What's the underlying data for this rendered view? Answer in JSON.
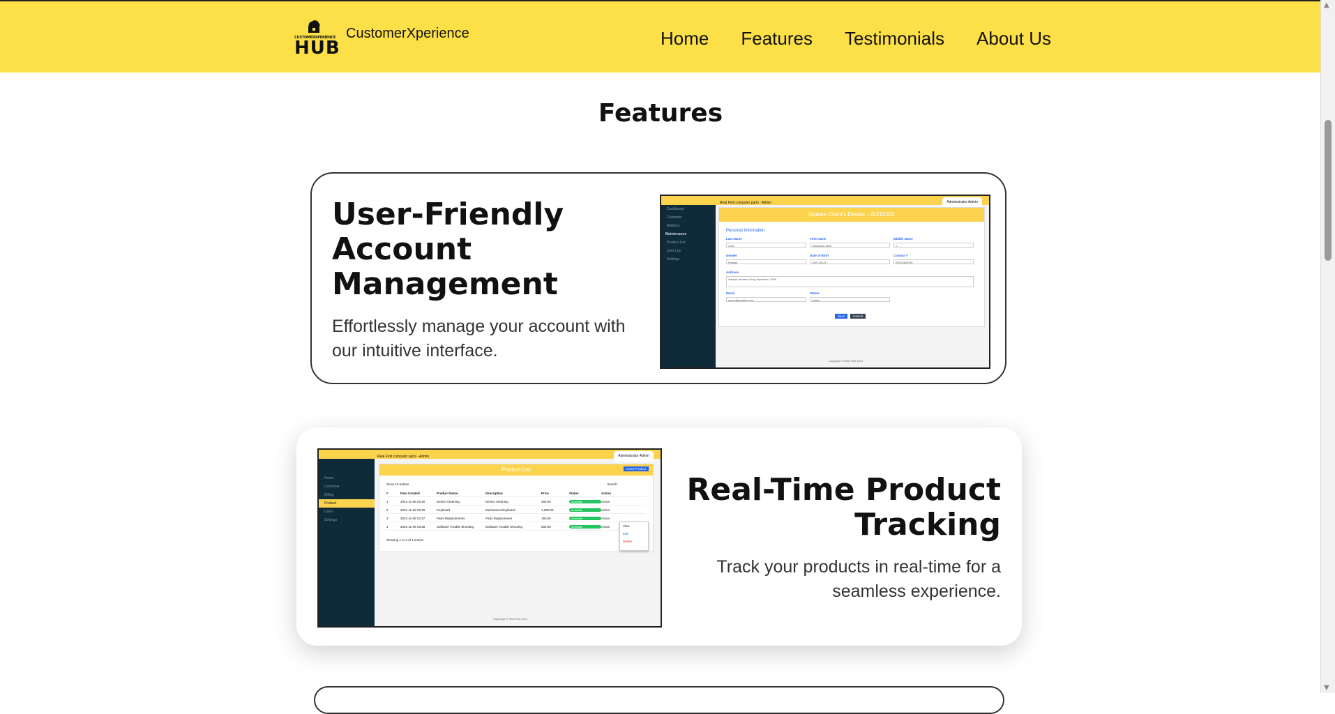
{
  "nav": {
    "logo_tagline": "CUSTOMERXPERIENCE",
    "logo_text": "HUB",
    "brand_name": "CustomerXperience",
    "links": [
      "Home",
      "Features",
      "Testimonials",
      "About Us"
    ]
  },
  "section": {
    "title": "Features"
  },
  "features": [
    {
      "title": "User-Friendly Account Management",
      "description": "Effortlessly manage your account with our intuitive interface.",
      "preview": {
        "app_title": "Real Finit computer parts - Admin",
        "admin_label": "Administrator Admin",
        "sidebar": [
          "Dashboard",
          "Customer",
          "Address",
          "Maintenance",
          "Product List",
          "User List",
          "Settings"
        ],
        "form_title": "Update Client's Details - 20210002",
        "section": "Personal Information",
        "labels": [
          "Last Name",
          "First Name",
          "Middle Name",
          "Gender",
          "Date of Birth",
          "Contact #",
          "Address",
          "Email",
          "Status"
        ],
        "values": [
          "Cruz",
          "Samantha Jane",
          "C",
          "Female",
          "1997-06-23",
          "09123456789",
          "Sample Address Only, Anywhere, 2306",
          "sjcruz@sample.com",
          "Active"
        ],
        "buttons": [
          "Save",
          "Cancel"
        ],
        "footer": "Copyright © Real Finit 2021"
      }
    },
    {
      "title": "Real-Time Product Tracking",
      "description": "Track your products in real-time for a seamless experience.",
      "preview": {
        "app_title": "Real Finit computer parts - Admin",
        "admin_label": "Administrator Admin",
        "sidebar": [
          "Home",
          "Customer",
          "Billing",
          "Product",
          "Users",
          "Settings"
        ],
        "active_item": "Product",
        "list_title": "Product List",
        "add_button": "Insert Product",
        "show_label": "Show 10 entries",
        "search_label": "Search:",
        "columns": [
          "#",
          "Date Created",
          "Product Name",
          "Description",
          "Price",
          "Status",
          "Action"
        ],
        "rows": [
          [
            "1",
            "2021-11-05 03:40",
            "Device Cleaning",
            "Device Cleaning",
            "250.00",
            "Available",
            "Action"
          ],
          [
            "2",
            "2021-11-02 02:30",
            "Keyboard",
            "Mechanical keyboard",
            "1,250.00",
            "Available",
            "Action"
          ],
          [
            "3",
            "2021-11-05 03:37",
            "Parts Replacements",
            "Parts Replacement",
            "150.00",
            "Available",
            "Action"
          ],
          [
            "4",
            "2021-11-05 03:38",
            "Software Trouble Shooting",
            "Software Trouble Shooting",
            "500.00",
            "Available",
            "Action"
          ]
        ],
        "showing": "Showing 1 to 4 of 4 entries",
        "menu": [
          "View",
          "Edit",
          "Delete"
        ],
        "footer": "Copyright © Real Finit 2021"
      }
    }
  ],
  "colors": {
    "brand_yellow": "#fde047",
    "sidebar_dark": "#0f2b3a",
    "text_dark": "#111111"
  }
}
